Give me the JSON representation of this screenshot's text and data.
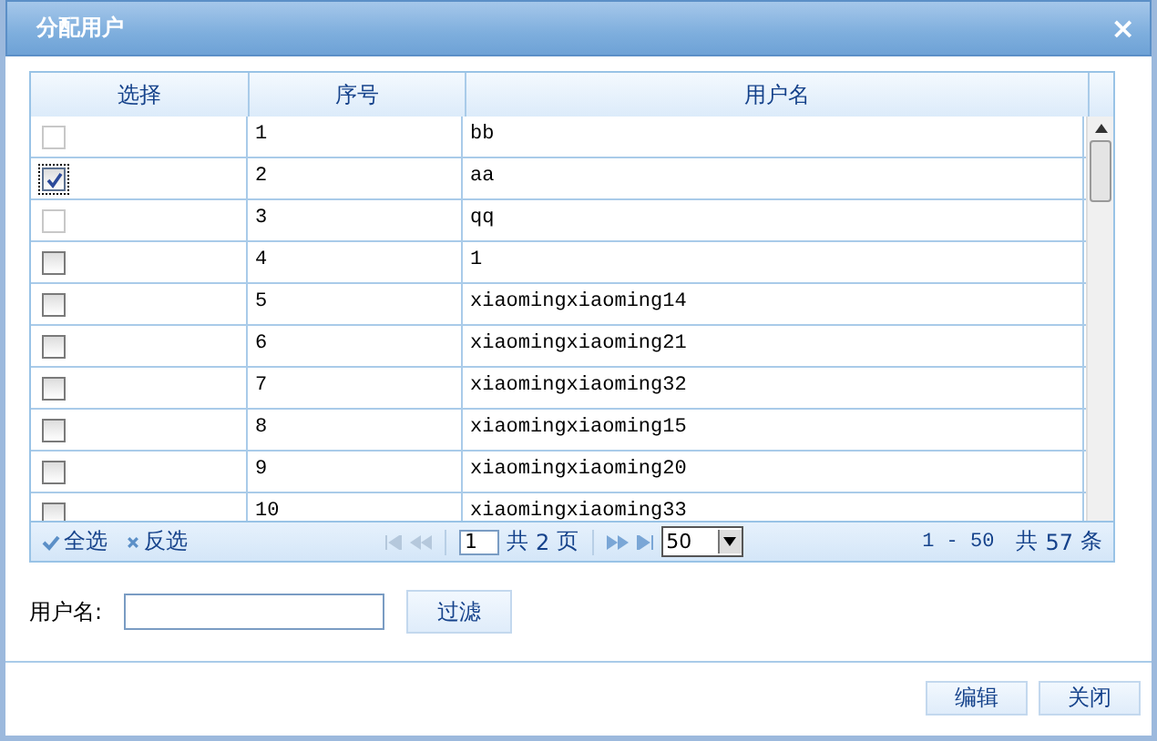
{
  "window": {
    "title": "分配用户",
    "close": "×"
  },
  "table": {
    "columns": [
      "选择",
      "序号",
      "用户名"
    ],
    "rows": [
      {
        "checked": false,
        "disabled": true,
        "no": "1",
        "name": "bb"
      },
      {
        "checked": true,
        "disabled": false,
        "no": "2",
        "name": "aa"
      },
      {
        "checked": false,
        "disabled": true,
        "no": "3",
        "name": "qq"
      },
      {
        "checked": false,
        "disabled": false,
        "no": "4",
        "name": "1"
      },
      {
        "checked": false,
        "disabled": false,
        "no": "5",
        "name": "xiaomingxiaoming14"
      },
      {
        "checked": false,
        "disabled": false,
        "no": "6",
        "name": "xiaomingxiaoming21"
      },
      {
        "checked": false,
        "disabled": false,
        "no": "7",
        "name": "xiaomingxiaoming32"
      },
      {
        "checked": false,
        "disabled": false,
        "no": "8",
        "name": "xiaomingxiaoming15"
      },
      {
        "checked": false,
        "disabled": false,
        "no": "9",
        "name": "xiaomingxiaoming20"
      },
      {
        "checked": false,
        "disabled": false,
        "no": "10",
        "name": "xiaomingxiaoming33"
      }
    ]
  },
  "pager": {
    "select_all": "全选",
    "invert": "反选",
    "page": "1",
    "total_label": "共",
    "pages": "2",
    "page_unit": "页",
    "page_size": "50",
    "range": "1 - 50",
    "count_label": "共",
    "count": "57",
    "count_unit": "条"
  },
  "filter": {
    "label": "用户名:",
    "button": "过滤"
  },
  "buttons": [
    "编辑",
    "关闭"
  ]
}
